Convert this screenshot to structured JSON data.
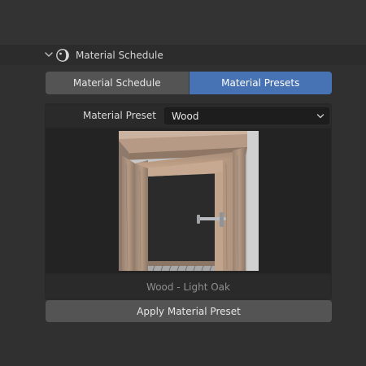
{
  "panel": {
    "title": "Material Schedule",
    "icon": "shader-ball-icon",
    "expanded": true
  },
  "tabs": [
    {
      "label": "Material Schedule",
      "active": false
    },
    {
      "label": "Material Presets",
      "active": true
    }
  ],
  "preset": {
    "label": "Material Preset",
    "value": "Wood"
  },
  "preview": {
    "caption": "Wood - Light Oak",
    "image": "door-preview-icon"
  },
  "apply_button": {
    "label": "Apply Material Preset"
  },
  "colors": {
    "background": "#303030",
    "accent": "#4772b3",
    "button": "#545454",
    "field": "#1d1d1d"
  }
}
